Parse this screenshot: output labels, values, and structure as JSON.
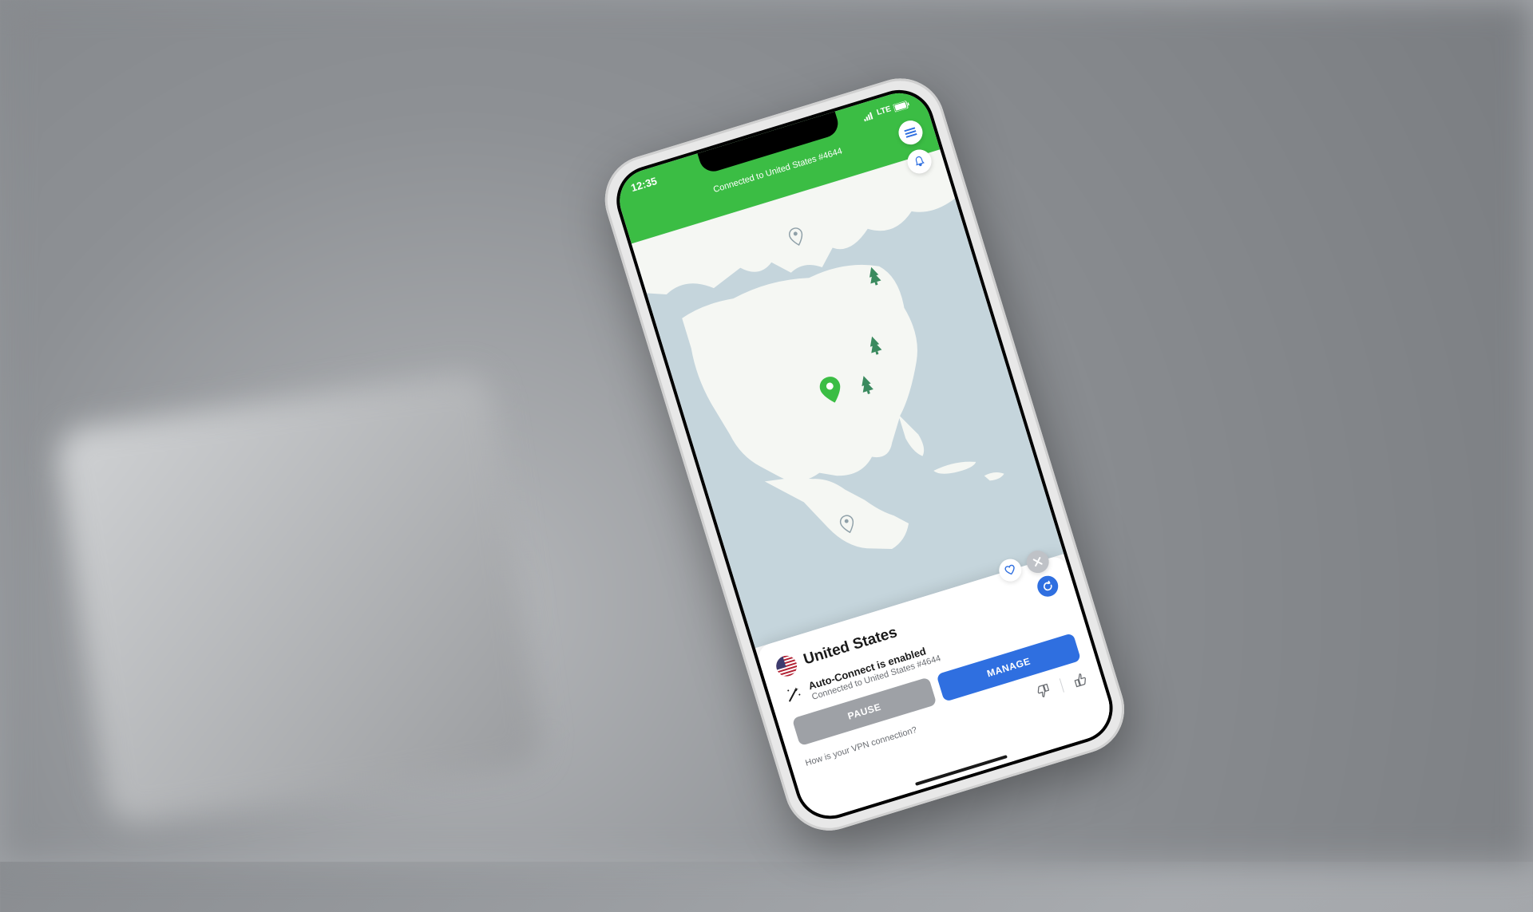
{
  "status": {
    "time": "12:35",
    "network": "LTE"
  },
  "header": {
    "connection_text": "Connected to United States #4644"
  },
  "card": {
    "country": "United States",
    "autoconnect_title": "Auto-Connect is enabled",
    "autoconnect_sub": "Connected to United States #4644",
    "pause_label": "PAUSE",
    "manage_label": "MANAGE",
    "rate_question": "How is your VPN connection?"
  },
  "colors": {
    "accent_green": "#3bbd44",
    "accent_blue": "#2f6fe0",
    "map_water": "#c5d5dc",
    "map_land": "#f5f7f3"
  }
}
